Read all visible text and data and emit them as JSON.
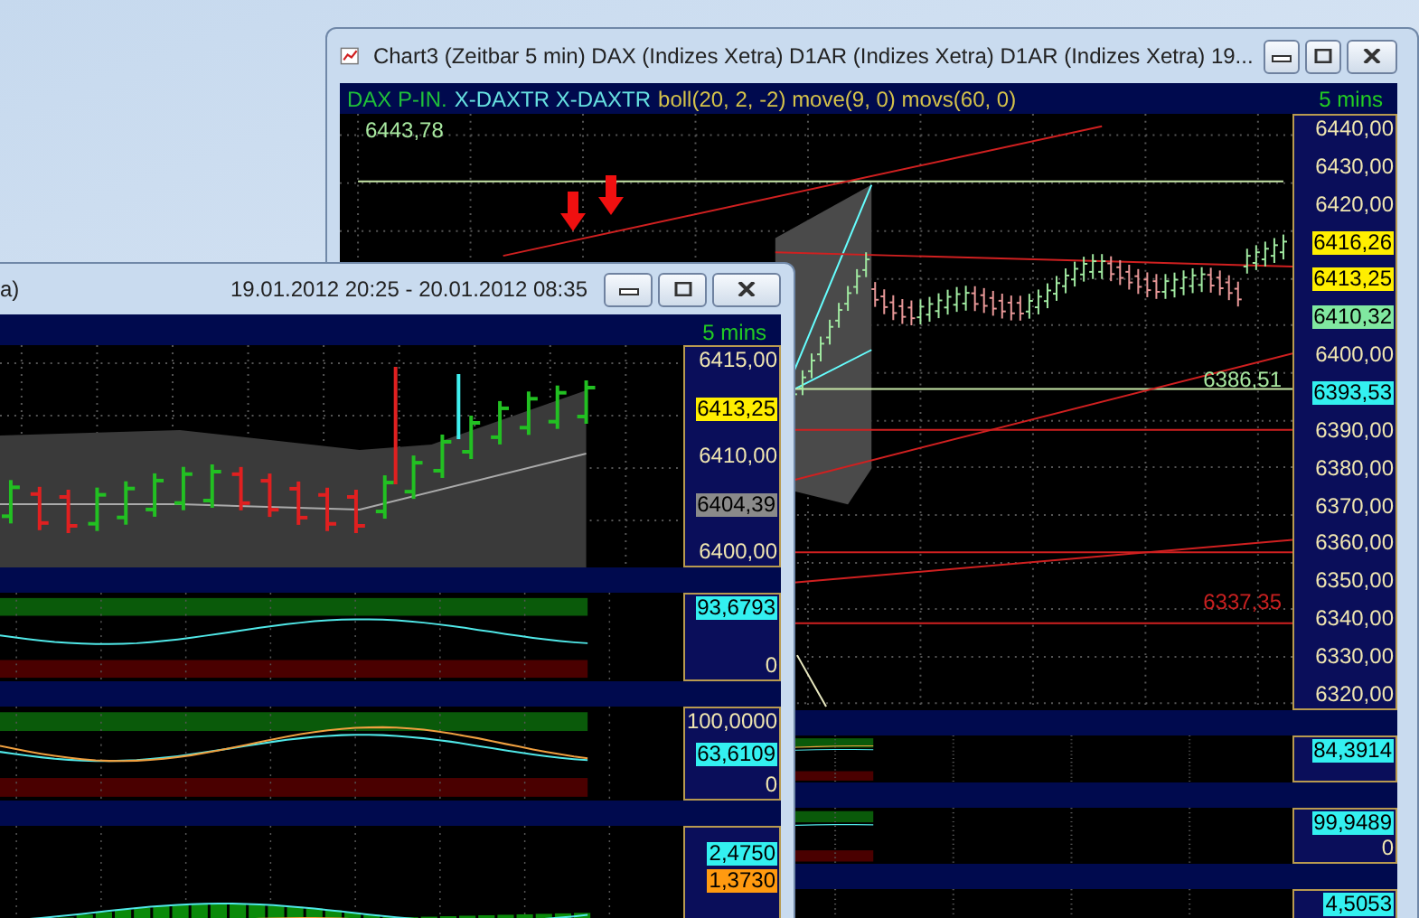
{
  "windows": [
    {
      "title": "Chart3 (Zeitbar 5 min)  DAX (Indizes Xetra) D1AR (Indizes Xetra) D1AR (Indizes Xetra) 19...",
      "legend": [
        {
          "text": "DAX P-IN.",
          "color": "#1fbf3a"
        },
        {
          "text": "X-DAXTR X-DAXTR",
          "color": "#66e0e0"
        },
        {
          "text": "boll(20, 2, -2) move(9, 0) movs(60, 0)",
          "color": "#d4c24a"
        }
      ],
      "interval": "5 mins",
      "panels": [
        {
          "kind": "trendlines",
          "labels": [
            {
              "text": "6443,78",
              "color": "#a8e8a0"
            },
            {
              "text": "6386,51",
              "color": "#a8e8a0"
            },
            {
              "text": "6337,35",
              "color": "#c82020"
            }
          ],
          "axis": [
            {
              "kind": "tick",
              "text": "6440,00"
            },
            {
              "kind": "tick",
              "text": "6430,00"
            },
            {
              "kind": "tick",
              "text": "6420,00"
            },
            {
              "kind": "tag",
              "text": "6416,26",
              "color": "#ffee00"
            },
            {
              "kind": "tag",
              "text": "6413,25",
              "color": "#ffee00"
            },
            {
              "kind": "tag",
              "text": "6410,32",
              "color": "#80e8a0"
            },
            {
              "kind": "tick",
              "text": "6400,00"
            },
            {
              "kind": "tag",
              "text": "6393,53",
              "color": "#33f0f0"
            },
            {
              "kind": "tick",
              "text": "6390,00"
            },
            {
              "kind": "tick",
              "text": "6380,00"
            },
            {
              "kind": "tick",
              "text": "6370,00"
            },
            {
              "kind": "tick",
              "text": "6360,00"
            },
            {
              "kind": "tick",
              "text": "6350,00"
            },
            {
              "kind": "tick",
              "text": "6340,00"
            },
            {
              "kind": "tick",
              "text": "6330,00"
            },
            {
              "kind": "tick",
              "text": "6320,00"
            }
          ]
        },
        {
          "kind": "dual-oscillator",
          "axis": [
            {
              "kind": "tag",
              "text": "84,3914",
              "color": "#33f0f0"
            }
          ]
        },
        {
          "kind": "oscillator",
          "axis": [
            {
              "kind": "tag",
              "text": "99,9489",
              "color": "#33f0f0"
            },
            {
              "kind": "tick",
              "text": "0"
            }
          ]
        },
        {
          "kind": "histogram",
          "axis": [
            {
              "kind": "tag",
              "text": "4,5053",
              "color": "#33f0f0"
            }
          ]
        }
      ]
    },
    {
      "title": "a)",
      "date_range": "19.01.2012 20:25 - 20.01.2012 08:35",
      "interval": "5 mins",
      "panels": [
        {
          "kind": "bollinger",
          "axis": [
            {
              "kind": "tick",
              "text": "6415,00"
            },
            {
              "kind": "tag",
              "text": "6413,25",
              "color": "#ffee00"
            },
            {
              "kind": "tick",
              "text": "6410,00"
            },
            {
              "kind": "tag",
              "text": "6404,39",
              "color": "#8a8a8a"
            },
            {
              "kind": "tick",
              "text": "6400,00"
            }
          ]
        },
        {
          "kind": "oscillator",
          "axis": [
            {
              "kind": "tag",
              "text": "93,6793",
              "color": "#33f0f0"
            },
            {
              "kind": "tick",
              "text": "0"
            }
          ]
        },
        {
          "kind": "dual-oscillator",
          "axis": [
            {
              "kind": "tick",
              "text": "100,0000"
            },
            {
              "kind": "tag",
              "text": "63,6109",
              "color": "#33f0f0"
            },
            {
              "kind": "tick",
              "text": "0"
            }
          ]
        },
        {
          "kind": "histogram",
          "axis": [
            {
              "kind": "tag",
              "text": "2,4750",
              "color": "#33f0f0"
            },
            {
              "kind": "tag",
              "text": "1,3730",
              "color": "#ff9a10"
            }
          ]
        }
      ]
    }
  ]
}
